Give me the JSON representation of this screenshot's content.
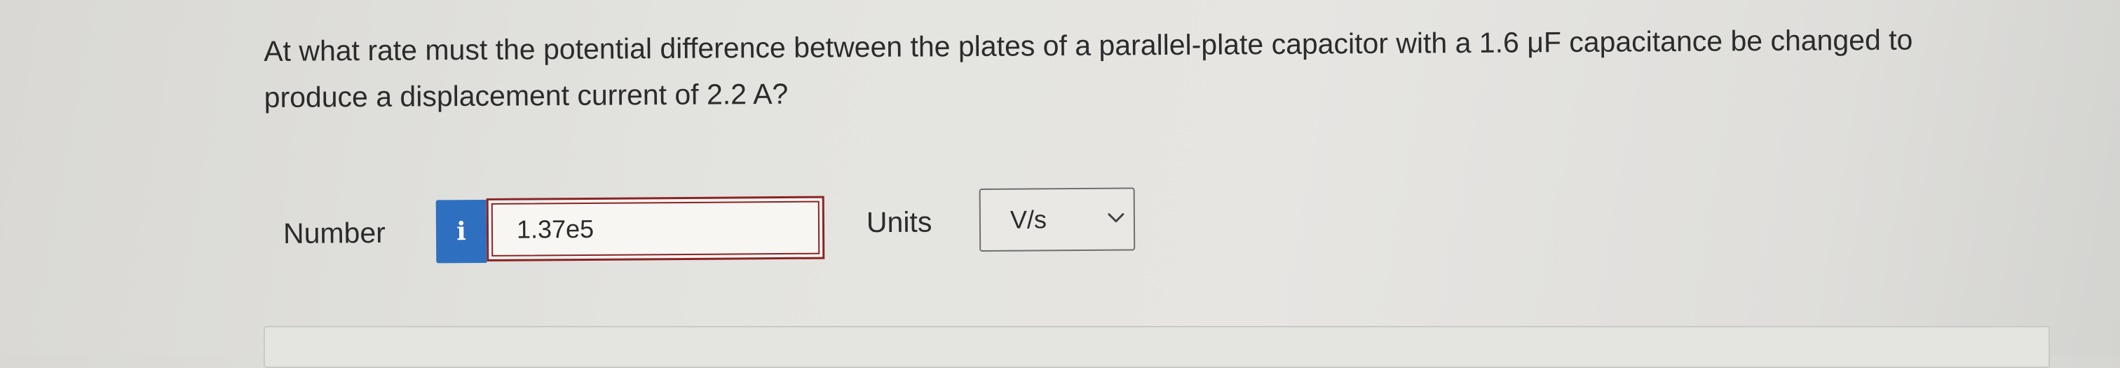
{
  "question": {
    "line1": "At what rate must the potential difference between the plates of a parallel-plate capacitor with a 1.6 μF capacitance be changed to",
    "line2": "produce a displacement current of 2.2 A?"
  },
  "answer": {
    "number_label": "Number",
    "info_button_label": "i",
    "number_value": "1.37e5",
    "units_label": "Units",
    "units_selected": "V/s",
    "units_icon": "chevron-down-icon"
  },
  "colors": {
    "info_button": "#2f6fc0",
    "input_border": "#8a2424",
    "text": "#2b2b2b"
  }
}
